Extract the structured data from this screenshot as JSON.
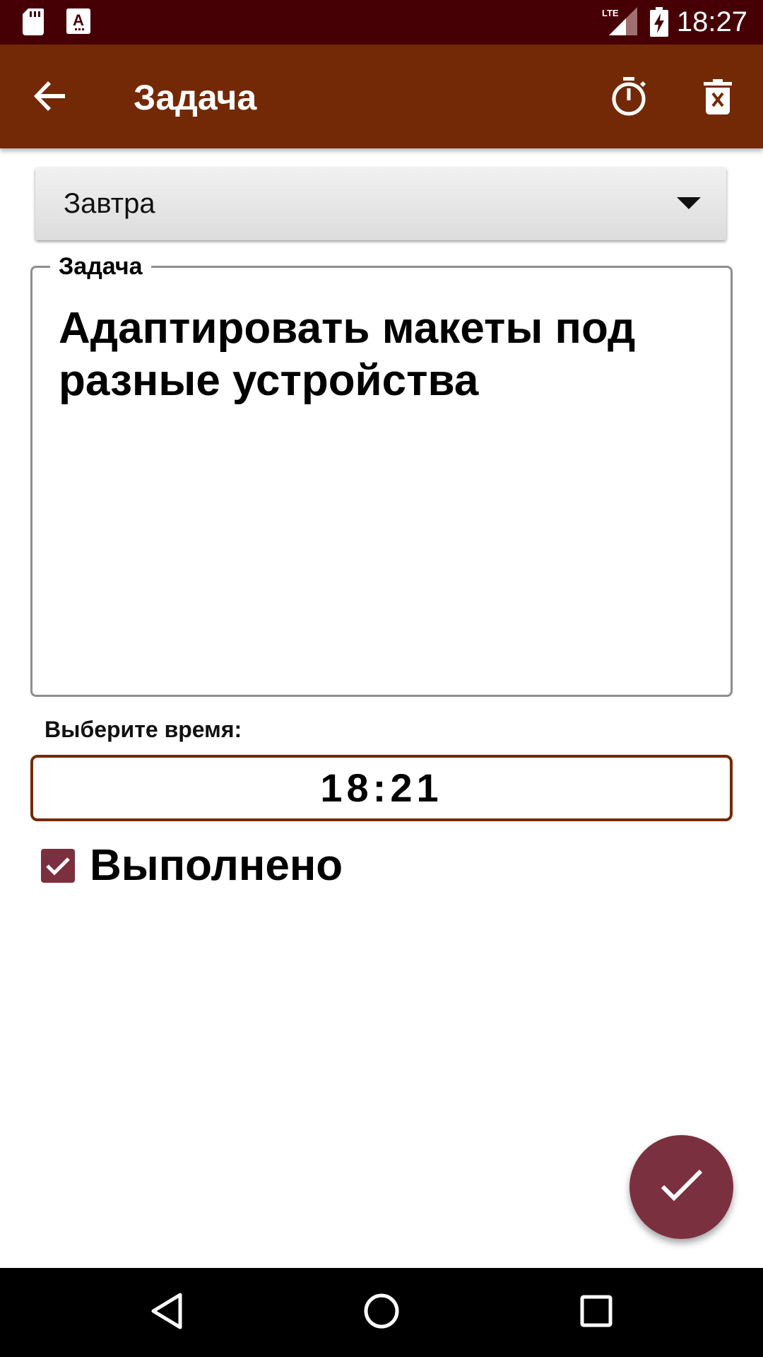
{
  "status_bar": {
    "time": "18:27",
    "network_label": "LTE",
    "icons": [
      "sd-card-icon",
      "keyboard-a-icon",
      "lte-signal-icon",
      "battery-charging-icon"
    ]
  },
  "app_bar": {
    "title": "Задача",
    "back_icon": "arrow-back-icon",
    "timer_icon": "timer-icon",
    "delete_icon": "delete-forever-icon"
  },
  "day_select": {
    "value": "Завтра"
  },
  "task": {
    "label": "Задача",
    "text": "Адаптировать макеты под разные устройства"
  },
  "time_picker": {
    "label": "Выберите время:",
    "value": "18:21"
  },
  "done": {
    "label": "Выполнено",
    "checked": true
  },
  "fab": {
    "icon": "check-icon"
  },
  "nav_bar": {
    "icons": [
      "nav-back-icon",
      "nav-home-icon",
      "nav-recents-icon"
    ]
  },
  "colors": {
    "status_bar": "#460005",
    "app_bar": "#742906",
    "accent": "#7b3040",
    "time_border": "#742906"
  }
}
